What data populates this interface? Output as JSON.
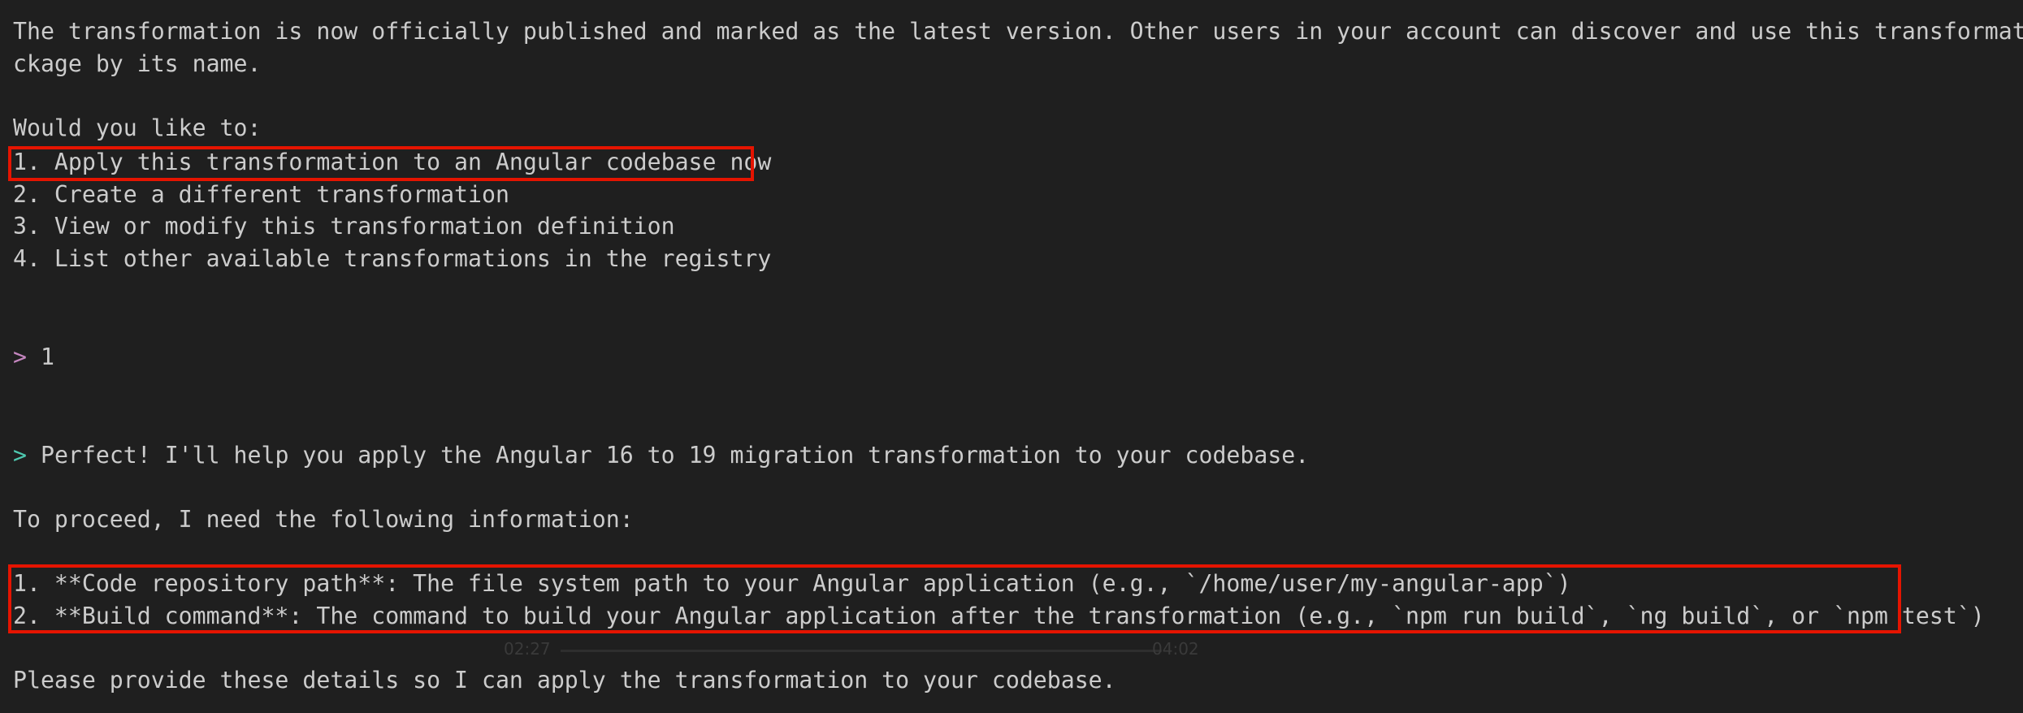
{
  "terminal": {
    "intro_line_1": "The transformation is now officially published and marked as the latest version. Other users in your account can discover and use this transformation pa",
    "intro_line_2": "ckage by its name.",
    "question": "Would you like to:",
    "options": [
      "1. Apply this transformation to an Angular codebase now",
      "2. Create a different transformation",
      "3. View or modify this transformation definition",
      "4. List other available transformations in the registry"
    ],
    "user_prompt_symbol": ">",
    "user_input": "1",
    "ai_prompt_symbol": ">",
    "ai_response": "Perfect! I'll help you apply the Angular 16 to 19 migration transformation to your codebase.",
    "proceed_text": "To proceed, I need the following information:",
    "requirements": [
      "1. **Code repository path**: The file system path to your Angular application (e.g., `/home/user/my-angular-app`)",
      "2. **Build command**: The command to build your Angular application after the transformation (e.g., `npm run build`, `ng build`, or `npm test`)"
    ],
    "closing": "Please provide these details so I can apply the transformation to your codebase."
  },
  "video_overlay": {
    "time_current": "02:27",
    "time_total": "04:02"
  },
  "colors": {
    "background": "#1f1f1f",
    "text": "#cccccc",
    "highlight": "#e51400",
    "user_prompt": "#c586c0",
    "ai_prompt": "#4ec9b0"
  }
}
